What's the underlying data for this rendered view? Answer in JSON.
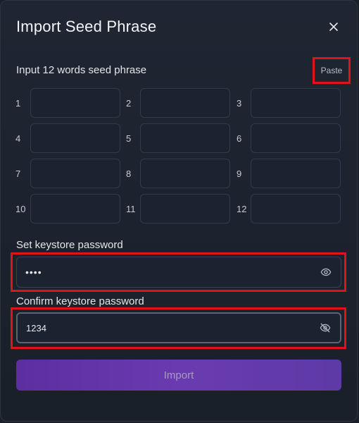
{
  "modal": {
    "title": "Import Seed Phrase",
    "close_icon": "close-icon"
  },
  "seed": {
    "label": "Input 12 words seed phrase",
    "paste_label": "Paste",
    "numbers": [
      "1",
      "2",
      "3",
      "4",
      "5",
      "6",
      "7",
      "8",
      "9",
      "10",
      "11",
      "12"
    ],
    "words": [
      "",
      "",
      "",
      "",
      "",
      "",
      "",
      "",
      "",
      "",
      "",
      ""
    ]
  },
  "password": {
    "label": "Set keystore password",
    "value": "••••",
    "eye_icon": "eye-icon"
  },
  "confirm": {
    "label": "Confirm keystore password",
    "value": "1234",
    "eye_icon": "eye-off-icon"
  },
  "import": {
    "label": "Import"
  },
  "colors": {
    "highlight": "#e0131c",
    "button": "#6a3bb0"
  }
}
